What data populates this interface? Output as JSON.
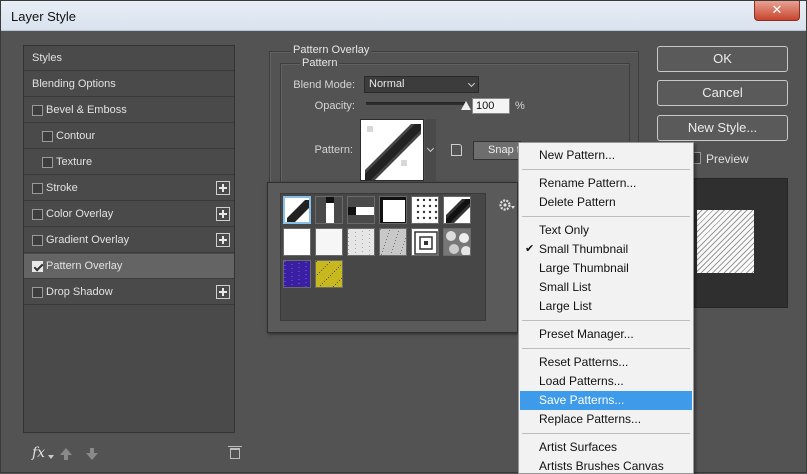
{
  "window": {
    "title": "Layer Style",
    "close_glyph": "✕"
  },
  "left_panel": {
    "items": [
      {
        "label": "Styles",
        "checkbox": false,
        "checked": false,
        "plus": false,
        "indent": 0
      },
      {
        "label": "Blending Options",
        "checkbox": false,
        "checked": false,
        "plus": false,
        "indent": 0
      },
      {
        "label": "Bevel & Emboss",
        "checkbox": true,
        "checked": false,
        "plus": false,
        "indent": 0
      },
      {
        "label": "Contour",
        "checkbox": true,
        "checked": false,
        "plus": false,
        "indent": 1
      },
      {
        "label": "Texture",
        "checkbox": true,
        "checked": false,
        "plus": false,
        "indent": 1
      },
      {
        "label": "Stroke",
        "checkbox": true,
        "checked": false,
        "plus": true,
        "indent": 0
      },
      {
        "label": "Color Overlay",
        "checkbox": true,
        "checked": false,
        "plus": true,
        "indent": 0
      },
      {
        "label": "Gradient Overlay",
        "checkbox": true,
        "checked": false,
        "plus": true,
        "indent": 0
      },
      {
        "label": "Pattern Overlay",
        "checkbox": true,
        "checked": true,
        "plus": false,
        "indent": 0,
        "selected": true
      },
      {
        "label": "Drop Shadow",
        "checkbox": true,
        "checked": false,
        "plus": true,
        "indent": 0
      }
    ],
    "footer": {
      "fx_label": "fx"
    }
  },
  "pattern_overlay": {
    "group_title": "Pattern Overlay",
    "subgroup_title": "Pattern",
    "blend_mode_label": "Blend Mode:",
    "blend_mode_value": "Normal",
    "opacity_label": "Opacity:",
    "opacity_value": "100",
    "opacity_unit": "%",
    "opacity_fraction": 1.0,
    "pattern_label": "Pattern:",
    "snap_button_label": "Snap to Origin"
  },
  "pattern_picker": {
    "thumbnails": [
      {
        "name": "diagonal-stripe-pattern",
        "selected": true
      },
      {
        "name": "vertical-bar-pattern"
      },
      {
        "name": "horizontal-bar-pattern"
      },
      {
        "name": "black-frame-pattern"
      },
      {
        "name": "dots-pattern"
      },
      {
        "name": "stair-diagonal-pattern"
      },
      {
        "name": "white-pattern"
      },
      {
        "name": "white-soft-pattern"
      },
      {
        "name": "light-noise-pattern"
      },
      {
        "name": "gray-noise-pattern"
      },
      {
        "name": "concentric-squares-pattern"
      },
      {
        "name": "stone-pattern"
      },
      {
        "name": "purple-texture-pattern"
      },
      {
        "name": "yellow-texture-pattern"
      }
    ]
  },
  "context_menu": {
    "items": [
      {
        "label": "New Pattern...",
        "separator_after": true
      },
      {
        "label": "Rename Pattern..."
      },
      {
        "label": "Delete Pattern",
        "separator_after": true
      },
      {
        "label": "Text Only"
      },
      {
        "label": "Small Thumbnail",
        "checked": true
      },
      {
        "label": "Large Thumbnail"
      },
      {
        "label": "Small List"
      },
      {
        "label": "Large List",
        "separator_after": true
      },
      {
        "label": "Preset Manager...",
        "separator_after": true
      },
      {
        "label": "Reset Patterns..."
      },
      {
        "label": "Load Patterns..."
      },
      {
        "label": "Save Patterns...",
        "highlighted": true
      },
      {
        "label": "Replace Patterns...",
        "separator_after": true
      },
      {
        "label": "Artist Surfaces"
      },
      {
        "label": "Artists Brushes Canvas"
      }
    ],
    "check_glyph": "✔"
  },
  "right_panel": {
    "ok_label": "OK",
    "cancel_label": "Cancel",
    "new_style_label": "New Style...",
    "preview_label": "Preview",
    "preview_checked": false
  }
}
